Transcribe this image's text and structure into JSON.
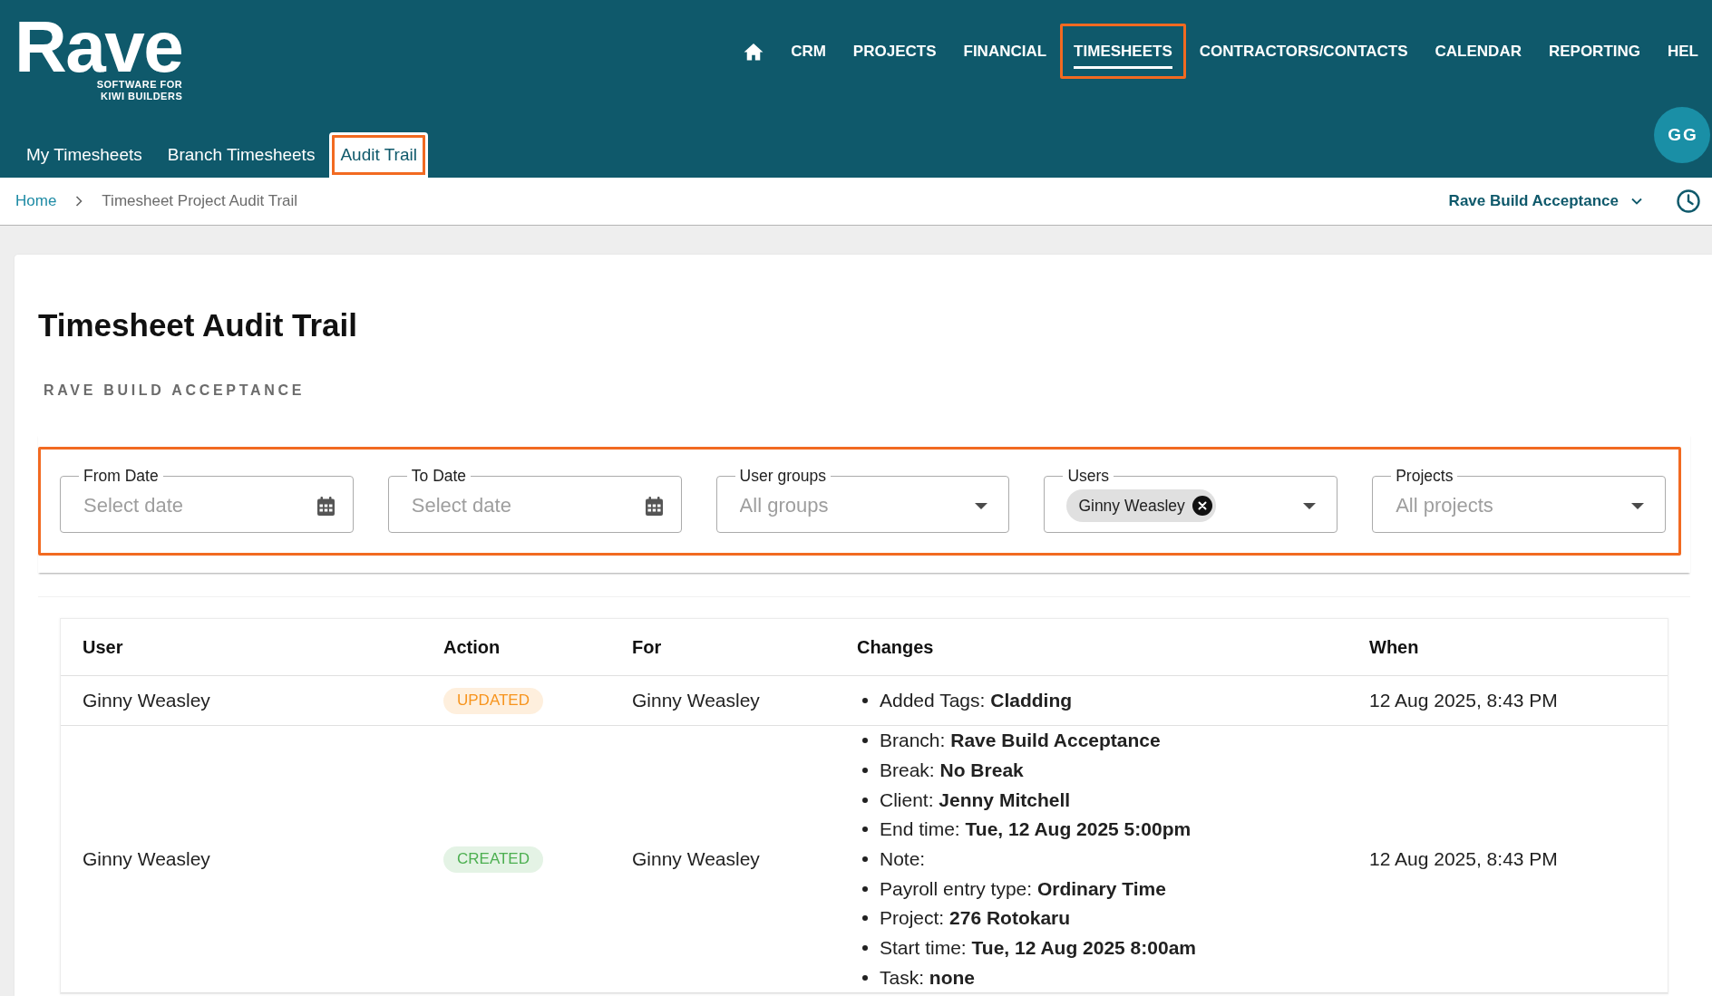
{
  "header": {
    "logo": {
      "wordmark": "Rave",
      "tagline": [
        "SOFTWARE FOR",
        "KIWI BUILDERS"
      ]
    },
    "nav": [
      {
        "kind": "home",
        "selected": false,
        "highlighted": false
      },
      {
        "kind": "link",
        "label": "CRM",
        "selected": false,
        "highlighted": false
      },
      {
        "kind": "link",
        "label": "PROJECTS",
        "selected": false,
        "highlighted": false
      },
      {
        "kind": "link",
        "label": "FINANCIAL",
        "selected": false,
        "highlighted": false
      },
      {
        "kind": "link",
        "label": "TIMESHEETS",
        "selected": true,
        "highlighted": true
      },
      {
        "kind": "link",
        "label": "CONTRACTORS/CONTACTS",
        "selected": false,
        "highlighted": false
      },
      {
        "kind": "link",
        "label": "CALENDAR",
        "selected": false,
        "highlighted": false
      },
      {
        "kind": "link",
        "label": "REPORTING",
        "selected": false,
        "highlighted": false
      },
      {
        "kind": "link",
        "label": "HEL",
        "selected": false,
        "highlighted": false
      }
    ],
    "subtabs": [
      {
        "label": "My Timesheets",
        "selected": false,
        "highlighted": false
      },
      {
        "label": "Branch Timesheets",
        "selected": false,
        "highlighted": false
      },
      {
        "label": "Audit Trail",
        "selected": true,
        "highlighted": true
      }
    ],
    "avatar": {
      "initials": "GG"
    }
  },
  "breadcrumb": {
    "items": [
      "Home",
      "Timesheet Project Audit Trail"
    ],
    "branch_selector": "Rave Build Acceptance"
  },
  "page": {
    "title": "Timesheet Audit Trail",
    "subtitle": "RAVE BUILD ACCEPTANCE"
  },
  "filters": {
    "highlighted": true,
    "fields": [
      {
        "kind": "date",
        "label": "From Date",
        "placeholder": "Select date"
      },
      {
        "kind": "date",
        "label": "To Date",
        "placeholder": "Select date"
      },
      {
        "kind": "select",
        "label": "User groups",
        "placeholder": "All groups"
      },
      {
        "kind": "multiselect",
        "label": "Users",
        "chips": [
          "Ginny Weasley"
        ]
      },
      {
        "kind": "select",
        "label": "Projects",
        "placeholder": "All projects"
      }
    ]
  },
  "table": {
    "columns": [
      "User",
      "Action",
      "For",
      "Changes",
      "When"
    ],
    "rows": [
      {
        "user": "Ginny Weasley",
        "action": {
          "label": "UPDATED",
          "color": "#f7941d"
        },
        "for": "Ginny Weasley",
        "changes": [
          {
            "label": "Added Tags:",
            "value": "Cladding"
          }
        ],
        "when": "12 Aug 2025, 8:43 PM"
      },
      {
        "user": "Ginny Weasley",
        "action": {
          "label": "CREATED",
          "color": "#4caf50"
        },
        "for": "Ginny Weasley",
        "changes": [
          {
            "label": "Branch:",
            "value": "Rave Build Acceptance"
          },
          {
            "label": "Break:",
            "value": "No Break"
          },
          {
            "label": "Client:",
            "value": "Jenny Mitchell"
          },
          {
            "label": "End time:",
            "value": "Tue, 12 Aug 2025 5:00pm"
          },
          {
            "label": "Note:"
          },
          {
            "label": "Payroll entry type:",
            "value": "Ordinary Time"
          },
          {
            "label": "Project:",
            "value": "276 Rotokaru"
          },
          {
            "label": "Start time:",
            "value": "Tue, 12 Aug 2025 8:00am"
          },
          {
            "label": "Task:",
            "value": "none"
          }
        ],
        "when": "12 Aug 2025, 8:43 PM"
      }
    ]
  }
}
